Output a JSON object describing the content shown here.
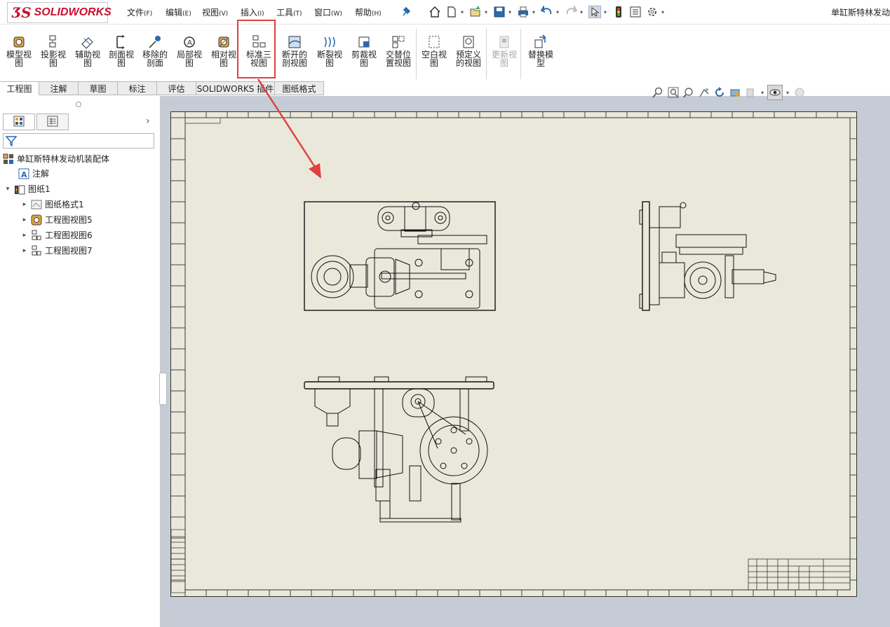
{
  "app": {
    "logo_ds": "ƷS",
    "logo_text": "SOLIDWORKS",
    "document_title": "单缸斯特林发动"
  },
  "menu": [
    {
      "label": "文件",
      "key": "(F)"
    },
    {
      "label": "编辑",
      "key": "(E)"
    },
    {
      "label": "视图",
      "key": "(V)"
    },
    {
      "label": "插入",
      "key": "(I)"
    },
    {
      "label": "工具",
      "key": "(T)"
    },
    {
      "label": "窗口",
      "key": "(W)"
    },
    {
      "label": "帮助",
      "key": "(H)"
    }
  ],
  "quick_access_icons": [
    "pin-icon",
    "home-icon",
    "new-document-icon",
    "open-folder-icon",
    "save-icon",
    "print-icon",
    "undo-icon",
    "redo-icon",
    "select-pointer-icon",
    "traffic-light-icon",
    "file-properties-icon",
    "options-gear-icon"
  ],
  "ribbon": [
    {
      "line1": "模型视",
      "line2": "图",
      "icon": "model-view-icon",
      "enabled": true
    },
    {
      "line1": "投影视",
      "line2": "图",
      "icon": "projected-view-icon",
      "enabled": true
    },
    {
      "line1": "辅助视",
      "line2": "图",
      "icon": "auxiliary-view-icon",
      "enabled": true
    },
    {
      "line1": "剖面视",
      "line2": "图",
      "icon": "section-view-icon",
      "enabled": true
    },
    {
      "line1": "移除的",
      "line2": "剖面",
      "icon": "removed-section-icon",
      "enabled": true
    },
    {
      "line1": "局部视",
      "line2": "图",
      "icon": "detail-view-icon",
      "enabled": true
    },
    {
      "line1": "相对视",
      "line2": "图",
      "icon": "relative-view-icon",
      "enabled": true
    },
    {
      "line1": "标准三",
      "line2": "视图",
      "icon": "standard-three-view-icon",
      "enabled": true
    },
    {
      "line1": "断开的",
      "line2": "剖视图",
      "icon": "broken-out-section-icon",
      "enabled": true
    },
    {
      "line1": "断裂视",
      "line2": "图",
      "icon": "break-view-icon",
      "enabled": true
    },
    {
      "line1": "剪裁视",
      "line2": "图",
      "icon": "crop-view-icon",
      "enabled": true
    },
    {
      "line1": "交替位",
      "line2": "置视图",
      "icon": "alternate-position-icon",
      "enabled": true
    },
    {
      "line1": "空白视",
      "line2": "图",
      "icon": "empty-view-icon",
      "enabled": true
    },
    {
      "line1": "预定义",
      "line2": "的视图",
      "icon": "predefined-view-icon",
      "enabled": true
    },
    {
      "line1": "更新视",
      "line2": "图",
      "icon": "update-view-icon",
      "enabled": false
    },
    {
      "line1": "替换模",
      "line2": "型",
      "icon": "replace-model-icon",
      "enabled": true
    }
  ],
  "tabs": [
    "工程图",
    "注解",
    "草图",
    "标注",
    "评估",
    "SOLIDWORKS 插件",
    "图纸格式"
  ],
  "active_tab": "工程图",
  "feature_tree": {
    "root": "单缸斯特林发动机装配体",
    "items": [
      {
        "label": "注解",
        "icon": "annotation-icon",
        "level": 1,
        "arrow": ""
      },
      {
        "label": "图纸1",
        "icon": "sheet-icon",
        "level": 0,
        "arrow": "▾"
      },
      {
        "label": "图纸格式1",
        "icon": "sheet-format-icon",
        "level": 2,
        "arrow": "▸"
      },
      {
        "label": "工程图视图5",
        "icon": "drawing-view-icon",
        "level": 2,
        "arrow": "▸"
      },
      {
        "label": "工程图视图6",
        "icon": "drawing-view-icon",
        "level": 2,
        "arrow": "▸"
      },
      {
        "label": "工程图视图7",
        "icon": "drawing-view-icon",
        "level": 2,
        "arrow": "▸"
      }
    ]
  },
  "colors": {
    "accent_red": "#e04040",
    "sheet_bg": "#e9e8da",
    "graphics_bg": "#c5ccd6",
    "logo_red": "#c8102e"
  }
}
